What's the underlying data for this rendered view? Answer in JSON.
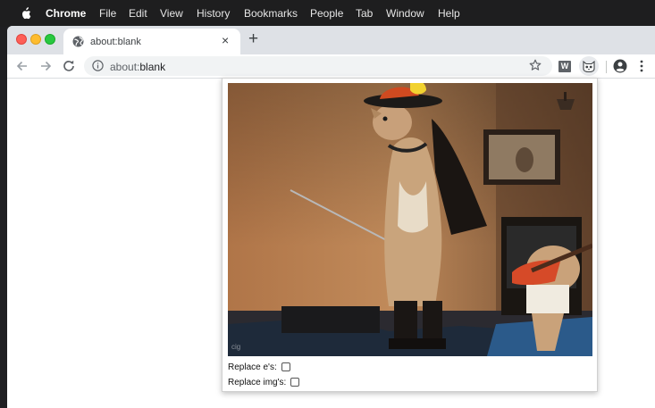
{
  "menubar": {
    "app_name": "Chrome",
    "items": [
      "File",
      "Edit",
      "View",
      "History",
      "Bookmarks",
      "People",
      "Tab",
      "Window",
      "Help"
    ]
  },
  "tab": {
    "title": "about:blank",
    "close_glyph": "×",
    "new_tab_glyph": "+"
  },
  "toolbar": {
    "url_prefix": "about:",
    "url_rest": "blank",
    "extension_w_label": "W"
  },
  "popup": {
    "options": [
      {
        "label": "Replace e's:",
        "checked": false
      },
      {
        "label": "Replace img's:",
        "checked": false
      }
    ],
    "watermark": "cig"
  },
  "colors": {
    "menubar_bg": "#1e1e1f",
    "tabstrip_bg": "#dee1e6",
    "omnibox_bg": "#f1f3f4",
    "traffic_red": "#fe5f57",
    "traffic_yellow": "#febc2e",
    "traffic_green": "#28c840"
  },
  "icons": [
    "apple-logo-icon",
    "globe-icon",
    "back-arrow-icon",
    "forward-arrow-icon",
    "reload-icon",
    "info-icon",
    "bookmark-star-icon",
    "w-extension-icon",
    "cat-extension-icon",
    "profile-icon",
    "kebab-menu-icon"
  ]
}
